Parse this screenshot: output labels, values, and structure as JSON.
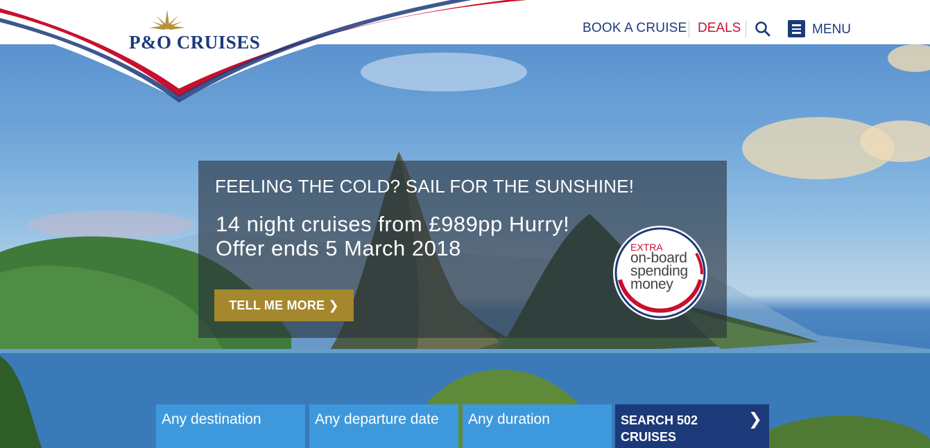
{
  "brand": {
    "logo_text": "P&O CRUISES"
  },
  "nav": {
    "book_label": "BOOK A CRUISE",
    "deals_label": "DEALS",
    "menu_label": "MENU"
  },
  "promo": {
    "headline": "FEELING THE COLD? SAIL FOR THE SUNSHINE!",
    "subline": "14 night cruises from £989pp Hurry! Offer ends 5 March 2018",
    "button_label": "TELL ME MORE ❯",
    "badge_extra": "EXTRA",
    "badge_text": "on-board spending money"
  },
  "search": {
    "destination": "Any destination",
    "departure": "Any departure date",
    "duration": "Any duration",
    "submit_label": "SEARCH 502 CRUISES",
    "submit_chevron": "❯"
  },
  "colors": {
    "navy": "#1c3a7a",
    "deals_red": "#c8102e",
    "gold_button": "#a5872e",
    "search_blue": "#3d99dc"
  }
}
